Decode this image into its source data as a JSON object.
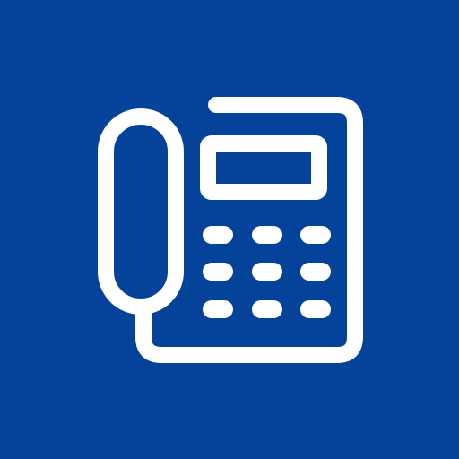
{
  "icon": {
    "name": "desk-phone-icon",
    "background_color": "#05439A",
    "foreground_color": "#FFFFFF"
  }
}
